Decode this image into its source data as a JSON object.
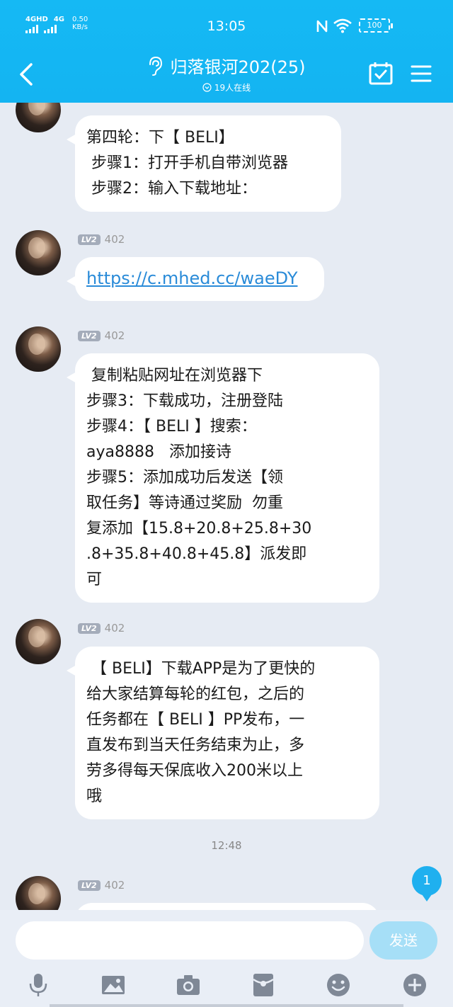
{
  "status_bar": {
    "network_1": "4GHD",
    "network_2": "4G",
    "speed_value": "0.50",
    "speed_unit": "KB/s",
    "time": "13:05",
    "battery": "100"
  },
  "header": {
    "title": "归落银河202(25)",
    "online": "19人在线"
  },
  "messages": [
    {
      "sender": "402",
      "level": "LV2",
      "lines": [
        "第四轮：下【 BELI】",
        " 步骤1：打开手机自带浏览器",
        " 步骤2：输入下载地址："
      ]
    },
    {
      "sender": "402",
      "level": "LV2",
      "link": "https://c.mhed.cc/waeDY"
    },
    {
      "sender": "402",
      "level": "LV2",
      "lines": [
        " 复制粘贴网址在浏览器下",
        "步骤3：下载成功，注册登陆",
        "步骤4：【 BELI 】搜索：",
        "aya8888   添加接诗",
        "步骤5：添加成功后发送【领",
        "取任务】等诗通过奖励  勿重",
        "复添加【15.8+20.8+25.8+30",
        ".8+35.8+40.8+45.8】派发即",
        "可"
      ]
    },
    {
      "sender": "402",
      "level": "LV2",
      "lines": [
        " 【 BELI】下载APP是为了更快的",
        "给大家结算每轮的红包，之后的",
        "任务都在【 BELI 】PP发布，一",
        "直发布到当天任务结束为止，多",
        "劳多得每天保底收入200米以上",
        "哦"
      ]
    },
    {
      "sender": "402",
      "level": "LV2"
    }
  ],
  "time_divider": "12:48",
  "unread_count": "1",
  "input": {
    "placeholder": "",
    "send_label": "发送"
  },
  "toolbar": [
    "mic-icon",
    "image-icon",
    "camera-icon",
    "red-packet-icon",
    "emoji-icon",
    "plus-icon"
  ]
}
